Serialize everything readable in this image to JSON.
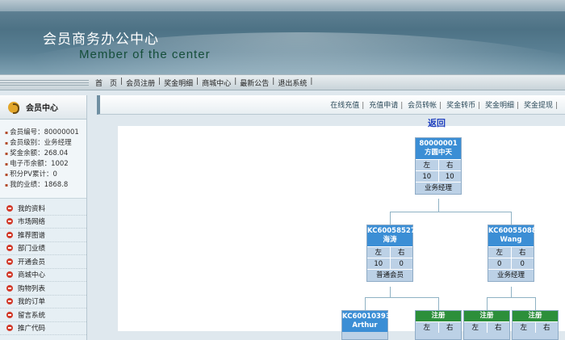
{
  "header": {
    "title_cn": "会员商务办公中心",
    "title_en": "Member of the center"
  },
  "nav": {
    "items": [
      "首　页",
      "会员注册",
      "奖金明细",
      "商城中心",
      "最新公告",
      "退出系统"
    ]
  },
  "sidebar": {
    "title": "会员中心",
    "info": [
      "会员编号：80000001",
      "会员级别：业务经理",
      "奖金余额：268.04",
      "电子币余额：1002",
      "积分PV累计：0",
      "我的业绩：1868.8"
    ],
    "menu": [
      "我的资料",
      "市场网络",
      "推荐图谱",
      "部门业绩",
      "开通会员",
      "商城中心",
      "购物列表",
      "我的订单",
      "留言系统",
      "推广代码"
    ]
  },
  "top_links": [
    "在线充值",
    "充值申请",
    "会员转帐",
    "奖金转币",
    "奖金明细",
    "奖金提现"
  ],
  "back_label": "返回",
  "tree": {
    "root": {
      "id": "80000001",
      "name": "方圆中天",
      "left_label": "左",
      "right_label": "右",
      "left": "10",
      "right": "10",
      "level": "业务经理"
    },
    "left": {
      "id": "KC60058527",
      "name": "海涛",
      "left_label": "左",
      "right_label": "右",
      "left": "10",
      "right": "0",
      "level": "普通会员"
    },
    "right": {
      "id": "KC60055088",
      "name": "Wang",
      "left_label": "左",
      "right_label": "右",
      "left": "0",
      "right": "0",
      "level": "业务经理"
    },
    "ll": {
      "id": "KC60010393",
      "name": "Arthur"
    },
    "reg_label": "注册",
    "left_label": "左",
    "right_label": "右"
  }
}
